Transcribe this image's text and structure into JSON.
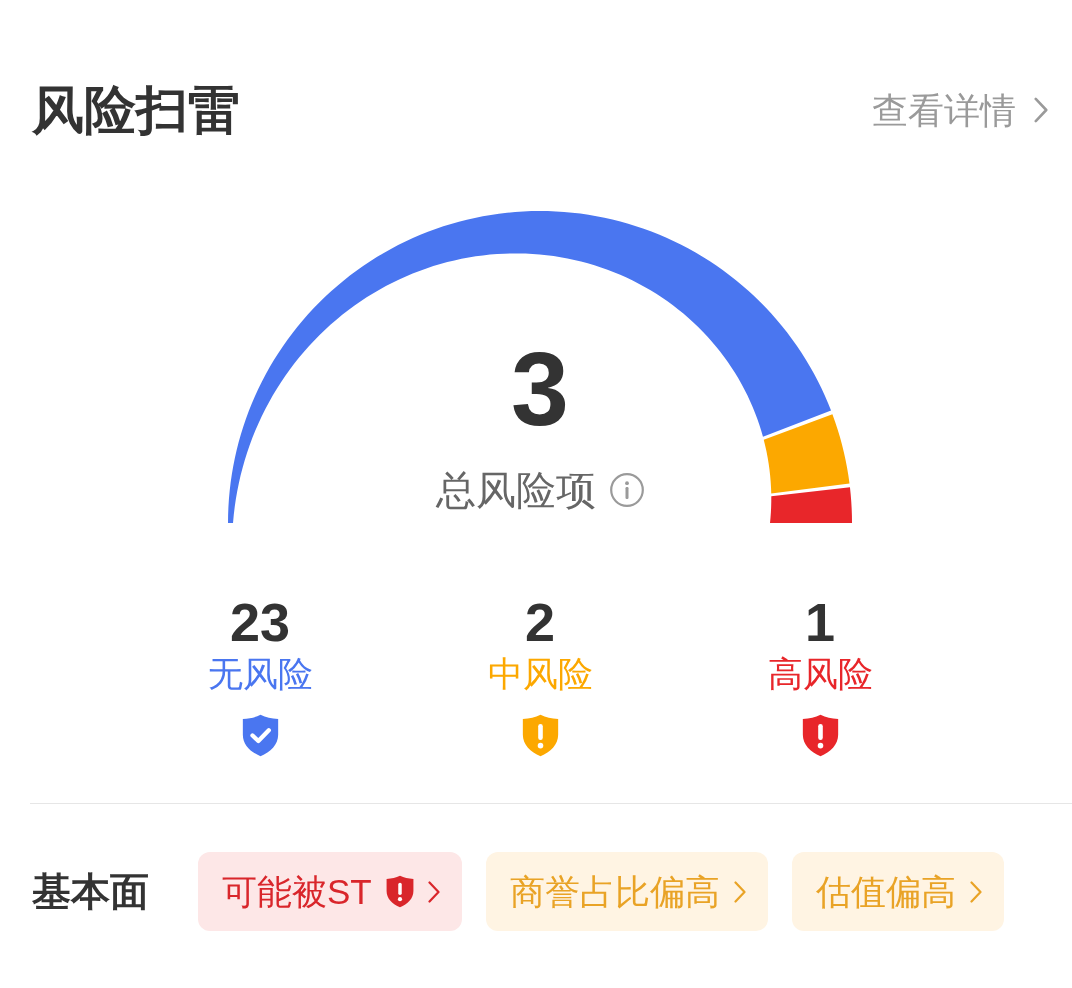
{
  "header": {
    "title": "风险扫雷",
    "link": "查看详情"
  },
  "gauge": {
    "total": "3",
    "total_label": "总风险项"
  },
  "levels": [
    {
      "count": "23",
      "label": "无风险",
      "color": "#4a76f0",
      "kind": "safe"
    },
    {
      "count": "2",
      "label": "中风险",
      "color": "#fca800",
      "kind": "warning"
    },
    {
      "count": "1",
      "label": "高风险",
      "color": "#e8262a",
      "kind": "warning"
    }
  ],
  "fundamentals": {
    "label": "基本面",
    "tags": [
      {
        "text": "可能被ST",
        "kind": "high"
      },
      {
        "text": "商誉占比偏高",
        "kind": "medium"
      },
      {
        "text": "估值偏高",
        "kind": "medium"
      }
    ]
  }
}
